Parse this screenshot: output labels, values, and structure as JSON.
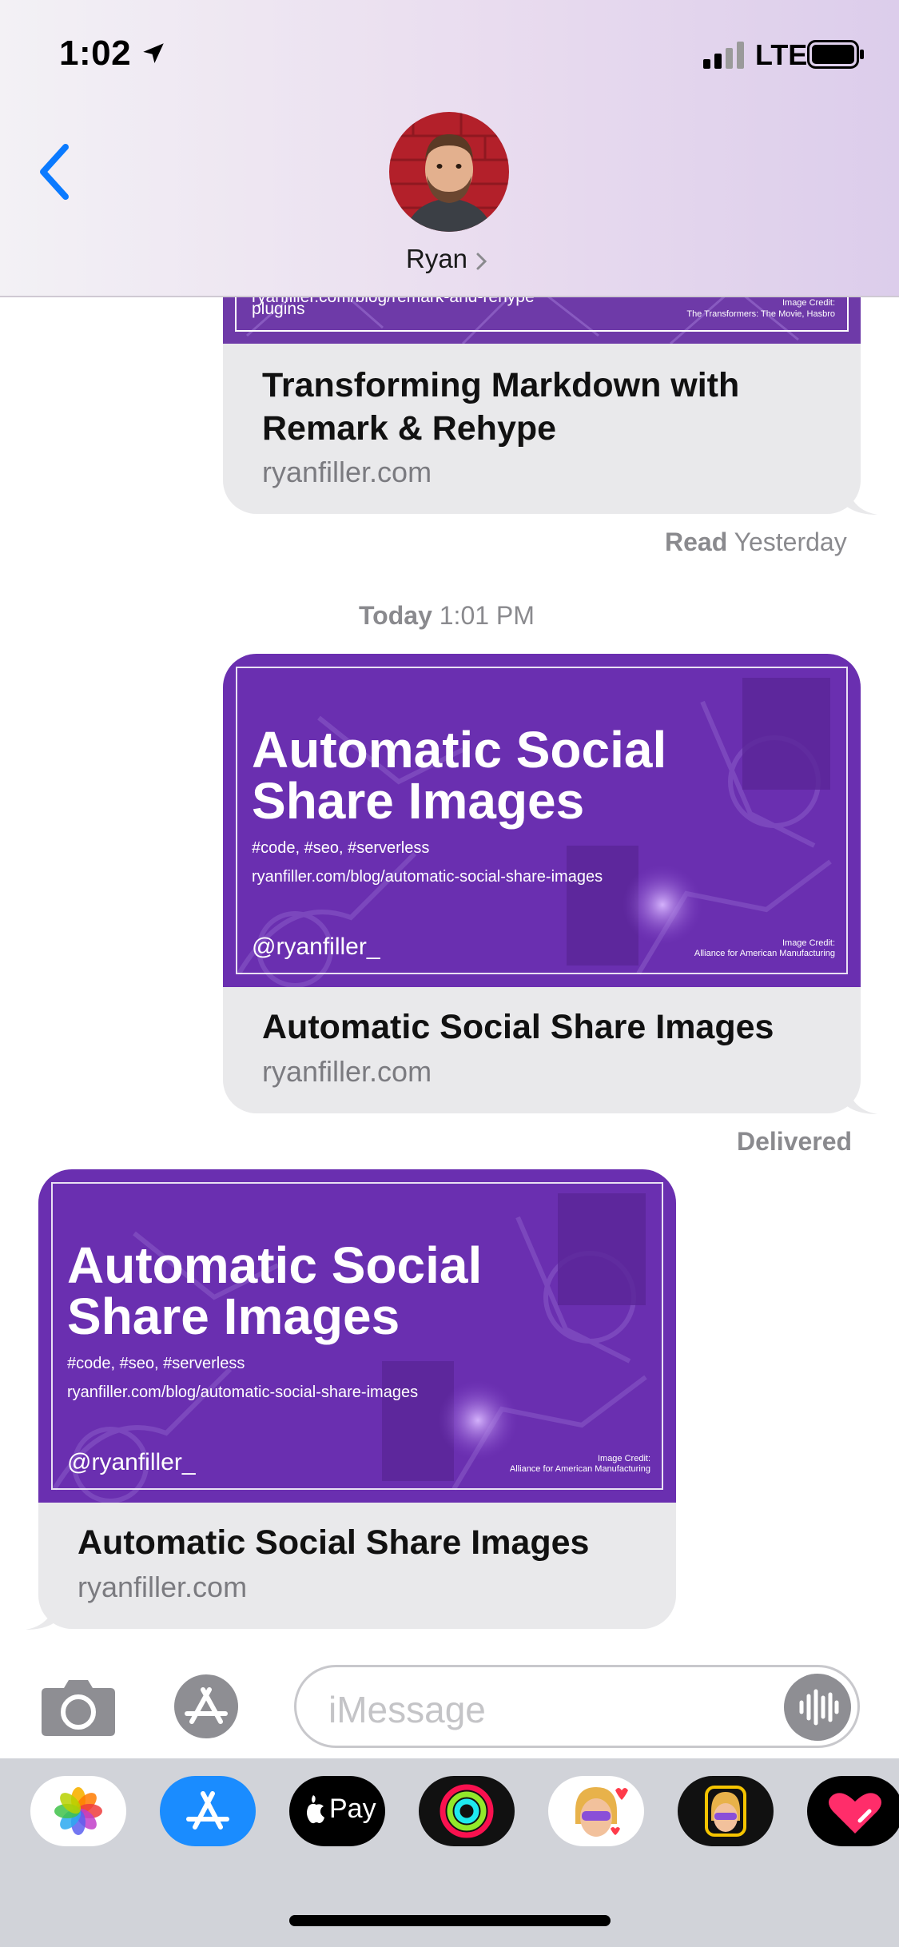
{
  "status_bar": {
    "time": "1:02",
    "carrier": "LTE",
    "icons": [
      "location-arrow-icon",
      "cellular-signal-icon",
      "battery-icon"
    ]
  },
  "header": {
    "back_icon": "chevron-left-icon",
    "contact_name": "Ryan",
    "contact_chevron": "chevron-right-icon"
  },
  "messages": [
    {
      "direction": "outgoing",
      "image_partial_lines": [
        "ryanfiller.com/blog/remark-and-rehype",
        "plugins"
      ],
      "image_credit": [
        "Image Credit:",
        "The Transformers: The Movie, Hasbro"
      ],
      "link_title": "Transforming Markdown with Remark & Rehype",
      "link_title_lines": [
        "Transforming Markdown with",
        "Remark & Rehype"
      ],
      "domain": "ryanfiller.com"
    },
    {
      "direction": "outgoing",
      "og": {
        "title_lines": [
          "Automatic Social",
          "Share Images"
        ],
        "tags": "#code,  #seo, #serverless",
        "url": "ryanfiller.com/blog/automatic-social-share-images",
        "handle": "@ryanfiller_",
        "credit": [
          "Image Credit:",
          "Alliance for American Manufacturing"
        ]
      },
      "link_title": "Automatic Social Share Images",
      "domain": "ryanfiller.com"
    },
    {
      "direction": "incoming",
      "og": {
        "title_lines": [
          "Automatic Social",
          "Share Images"
        ],
        "tags": "#code,  #seo, #serverless",
        "url": "ryanfiller.com/blog/automatic-social-share-images",
        "handle": "@ryanfiller_",
        "credit": [
          "Image Credit:",
          "Alliance for American Manufacturing"
        ]
      },
      "link_title": "Automatic Social Share Images",
      "domain": "ryanfiller.com"
    }
  ],
  "receipts": {
    "read_label": "Read",
    "read_time": "Yesterday",
    "timestamp_day": "Today",
    "timestamp_time": "1:01 PM",
    "delivered": "Delivered"
  },
  "composer": {
    "placeholder": "iMessage",
    "icons": [
      "camera-icon",
      "app-store-icon",
      "audio-waveform-icon"
    ]
  },
  "app_drawer": {
    "apps": [
      "photos-app-icon",
      "app-store-app-icon",
      "apple-pay-app-icon",
      "activity-app-icon",
      "memoji-stickers-app-icon",
      "animoji-app-icon",
      "digital-touch-app-icon"
    ],
    "apple_pay_label": "Pay"
  },
  "colors": {
    "accent": "#0a7aff",
    "bubble_gray": "#e9e9eb",
    "og_purple": "#6a2fb0"
  }
}
